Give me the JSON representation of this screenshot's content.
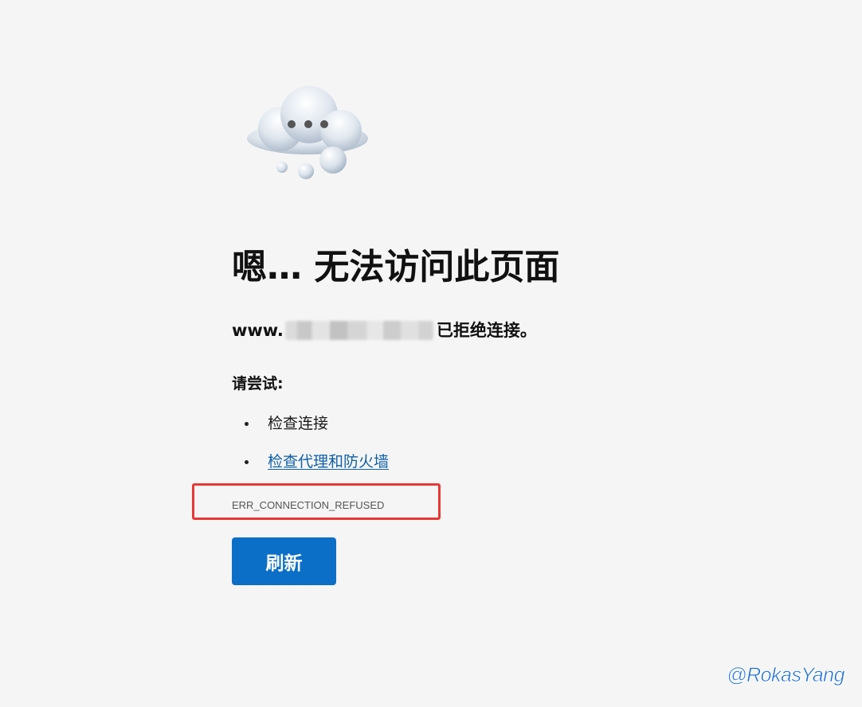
{
  "page": {
    "title": "嗯… 无法访问此页面",
    "host_prefix": "www.",
    "refused_text": "已拒绝连接。",
    "try_label": "请尝试:",
    "suggestions": [
      {
        "text": "检查连接",
        "is_link": false
      },
      {
        "text": "检查代理和防火墙",
        "is_link": true
      }
    ],
    "error_code": "ERR_CONNECTION_REFUSED",
    "refresh_label": "刷新"
  },
  "watermark": "@RokasYang",
  "colors": {
    "background": "#f5f5f5",
    "button": "#0b6fc8",
    "link": "#0f5fa8",
    "highlight": "#e53935",
    "watermark": "#1e6fe0"
  },
  "icons": {
    "illustration": "cloud-loading-icon"
  }
}
